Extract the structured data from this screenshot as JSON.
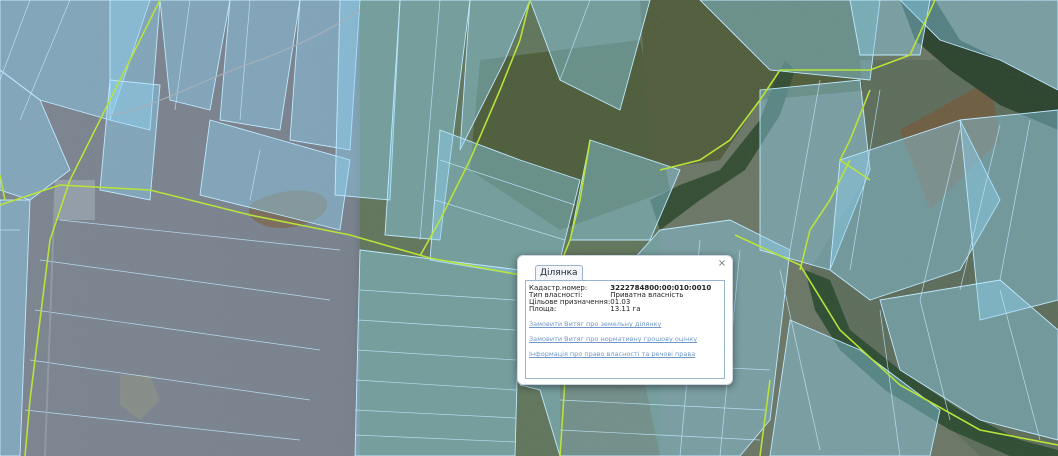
{
  "popup": {
    "tab_label": "Ділянка",
    "close_label": "×",
    "fields": [
      {
        "label": "Кадастр.номер:",
        "value": "3222784800:00:010:0010"
      },
      {
        "label": "Тип власності:",
        "value": "Приватна власність"
      },
      {
        "label": "Цільове призначення:",
        "value": "01.03"
      },
      {
        "label": "Площа:",
        "value": "13.11 га"
      }
    ],
    "links": [
      "Замовити Витяг про земельну ділянку",
      "Замовити Витяг про нормативну грошову оцінку",
      "Інформація про право власності та речові права"
    ]
  },
  "colors": {
    "parcel_fill": "#8fd3f4",
    "parcel_stroke": "#bfe9ff",
    "boundary_line": "#b7e33a",
    "link": "#6f98c9",
    "popup_border": "#9ab3d0"
  }
}
